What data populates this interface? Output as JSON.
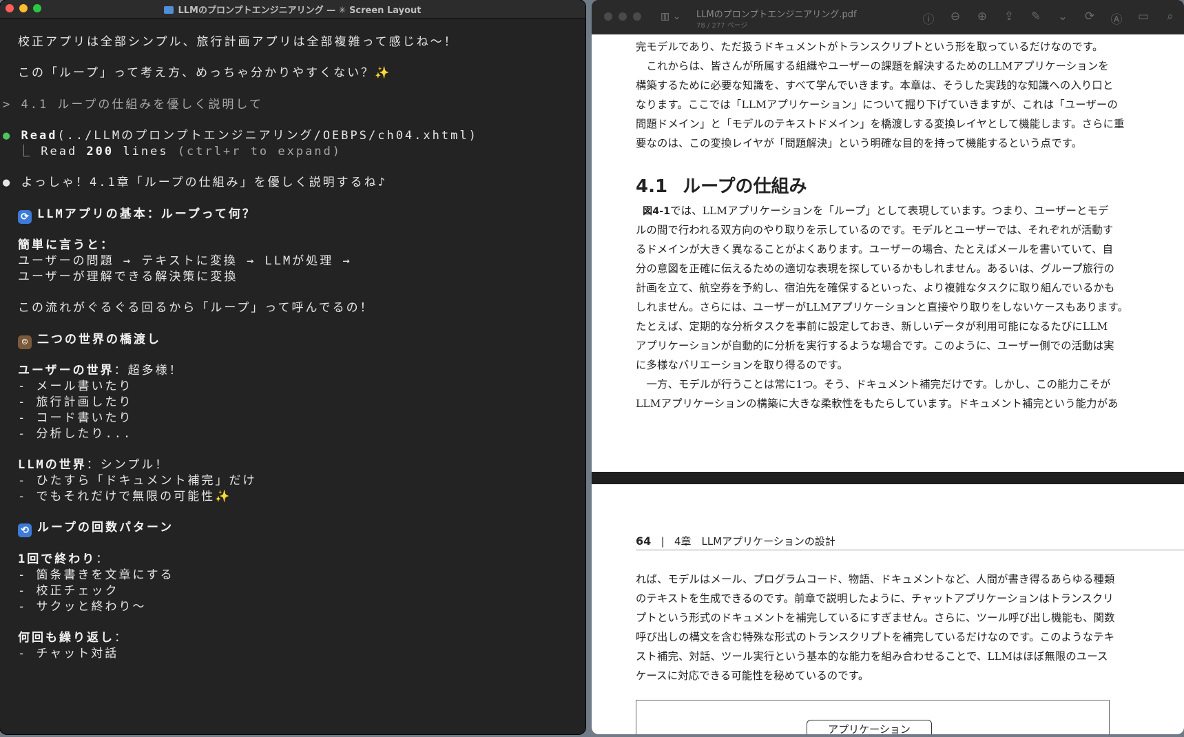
{
  "terminal": {
    "title": "LLMのプロンプトエンジニアリング — ✳ Screen Layout",
    "lines": {
      "l1": "校正アプリは全部シンプル、旅行計画アプリは全部複雑って感じね〜！",
      "l2": "この「ループ」って考え方、めっちゃ分かりやすくない？",
      "prompt": "4.1 ループの仕組みを優しく説明して",
      "read_cmd": "Read",
      "read_arg": "(../LLMのプロンプトエンジニアリング/OEBPS/ch04.xhtml)",
      "read_result_a": "Read ",
      "read_result_n": "200",
      "read_result_b": " lines",
      "read_hint": " (ctrl+r to expand)",
      "reply": "よっしゃ！4.1章「ループの仕組み」を優しく説明するね♪",
      "h1": "LLMアプリの基本：ループって何？",
      "simple": "簡単に言うと：",
      "flow1": "ユーザーの問題 → テキストに変換 → LLMが処理 →",
      "flow2": "ユーザーが理解できる解決策に変換",
      "loop_note": "この流れがぐるぐる回るから「ループ」って呼んでるの！",
      "h2": "二つの世界の橋渡し",
      "user_world_b": "ユーザーの世界",
      "user_world_r": "：超多様！",
      "u1": "- メール書いたり",
      "u2": "- 旅行計画したり",
      "u3": "- コード書いたり",
      "u4": "- 分析したり...",
      "llm_world_b": "LLMの世界",
      "llm_world_r": "：シンプル！",
      "m1": "- ひたすら「ドキュメント補完」だけ",
      "m2": "- でもそれだけで無限の可能性",
      "h3": "ループの回数パターン",
      "once_b": "1回で終わり",
      "once_r": "：",
      "o1": "- 箇条書きを文章にする",
      "o2": "- 校正チェック",
      "o3": "- サクッと終わり〜",
      "many_b": "何回も繰り返し",
      "many_r": "：",
      "r1": "- チャット対話"
    }
  },
  "pdf": {
    "title": "LLMのプロンプトエンジニアリング.pdf",
    "subtitle": "78 / 277 ページ",
    "page1": {
      "p0": "完モデルであり、ただ扱うドキュメントがトランスクリプトという形を取っているだけなのです。",
      "p1": "　これからは、皆さんが所属する組織やユーザーの課題を解決するためのLLMアプリケーションを",
      "p2": "構築するために必要な知識を、すべて学んでいきます。本章は、そうした実践的な知識への入り口と",
      "p3": "なります。ここでは「LLMアプリケーション」について掘り下げていきますが、これは「ユーザーの",
      "p4": "問題ドメイン」と「モデルのテキストドメイン」を橋渡しする変換レイヤとして機能します。さらに重",
      "p5": "要なのは、この変換レイヤが「問題解決」という明確な目的を持って機能するという点です。",
      "heading_num": "4.1",
      "heading_text": "ループの仕組み",
      "fig_ref": "図4-1",
      "q1": "では、LLMアプリケーションを「ループ」として表現しています。つまり、ユーザーとモデ",
      "q2": "ルの間で行われる双方向のやり取りを示しているのです。モデルとユーザーでは、それぞれが活動す",
      "q3": "るドメインが大きく異なることがよくあります。ユーザーの場合、たとえばメールを書いていて、自",
      "q4": "分の意図を正確に伝えるための適切な表現を探しているかもしれません。あるいは、グループ旅行の",
      "q5": "計画を立て、航空券を予約し、宿泊先を確保するといった、より複雑なタスクに取り組んでいるかも",
      "q6": "しれません。さらには、ユーザーがLLMアプリケーションと直接やり取りをしないケースもあります。",
      "q7": "たとえば、定期的な分析タスクを事前に設定しておき、新しいデータが利用可能になるたびにLLM",
      "q8": "アプリケーションが自動的に分析を実行するような場合です。このように、ユーザー側での活動は実",
      "q9": "に多様なバリエーションを取り得るのです。",
      "s1": "　一方、モデルが行うことは常に1つ。そう、ドキュメント補完だけです。しかし、この能力こそが",
      "s2": "LLMアプリケーションの構築に大きな柔軟性をもたらしています。ドキュメント補完という能力があ"
    },
    "page2": {
      "page_number": "64",
      "chapter": "4章　LLMアプリケーションの設計",
      "t1": "れば、モデルはメール、プログラムコード、物語、ドキュメントなど、人間が書き得るあらゆる種類",
      "t2": "のテキストを生成できるのです。前章で説明したように、チャットアプリケーションはトランスクリ",
      "t3": "プトという形式のドキュメントを補完しているにすぎません。さらに、ツール呼び出し機能も、関数",
      "t4": "呼び出しの構文を含む特殊な形式のトランスクリプトを補完しているだけなのです。このようなテキ",
      "t5": "スト補完、対話、ツール実行という基本的な能力を組み合わせることで、LLMはほぼ無限のユース",
      "t6": "ケースに対応できる可能性を秘めているのです。",
      "figure_label": "アプリケーション"
    }
  }
}
